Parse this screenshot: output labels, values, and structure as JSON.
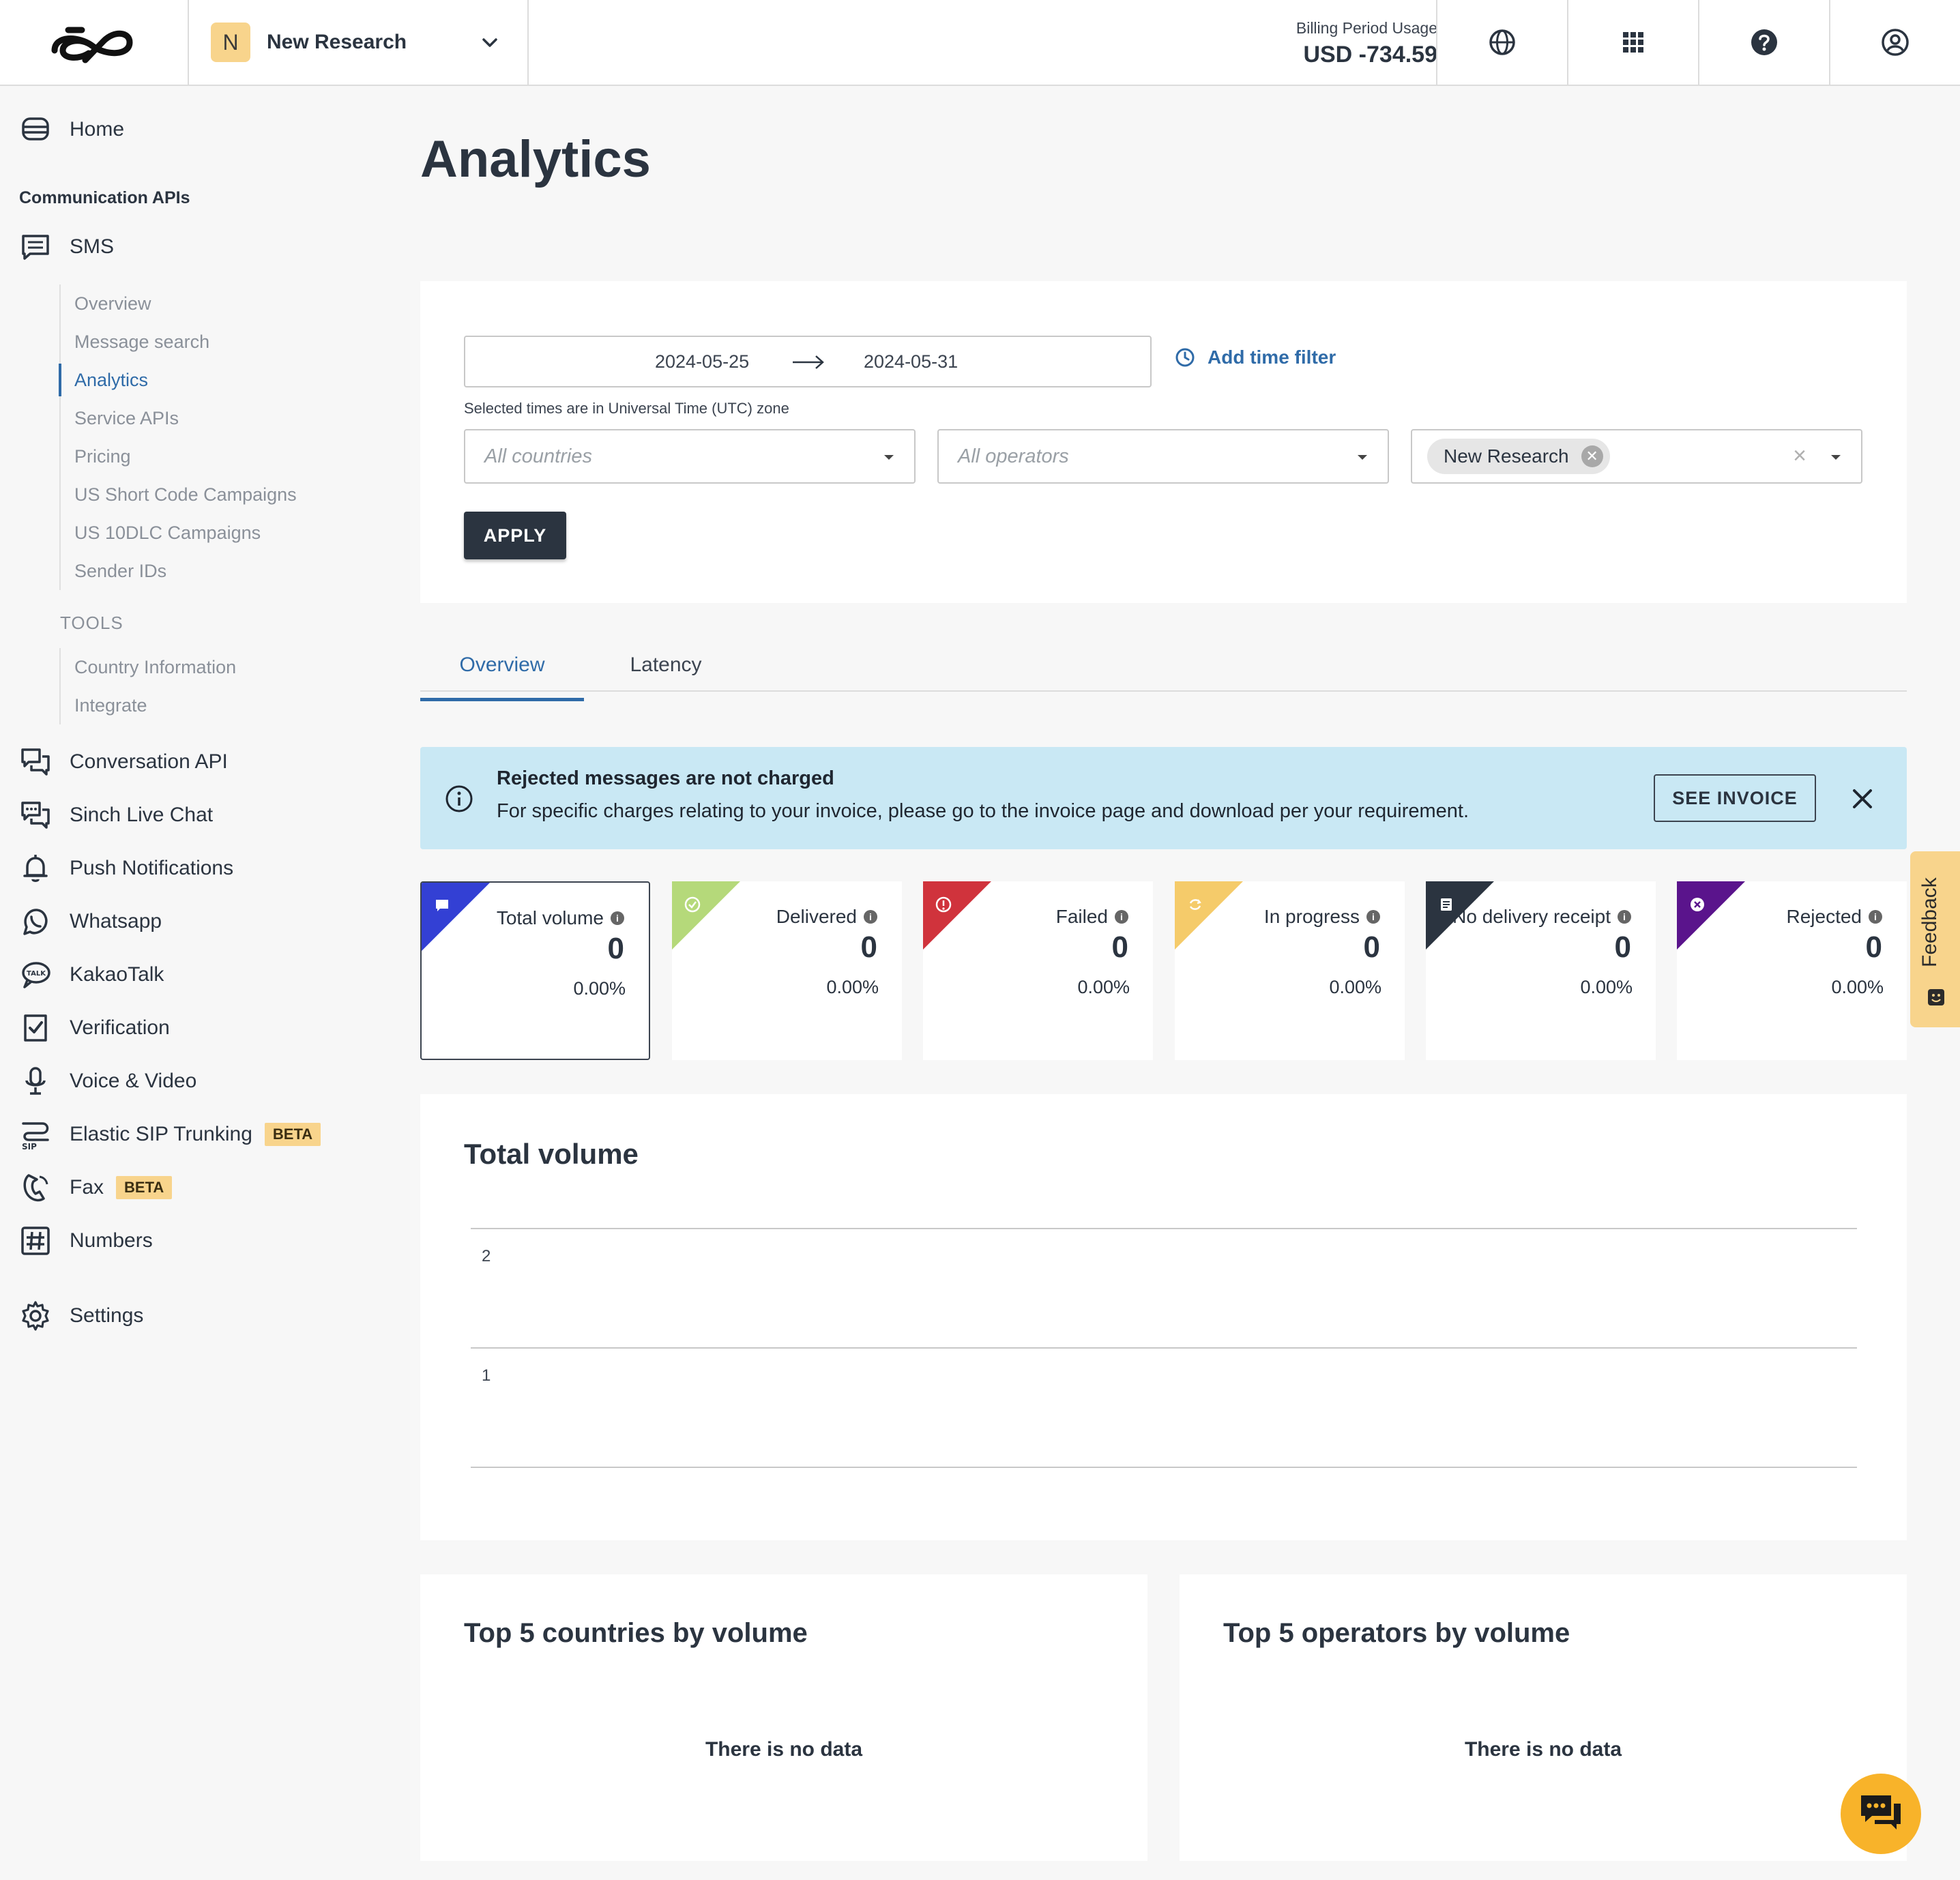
{
  "header": {
    "project_initial": "N",
    "project_name": "New Research",
    "billing_label": "Billing Period Usage",
    "billing_value": "USD -734.59",
    "icons": [
      "globe-icon",
      "apps-grid-icon",
      "help-icon",
      "account-icon"
    ]
  },
  "sidebar": {
    "home": "Home",
    "section_title": "Communication APIs",
    "sms": "SMS",
    "sms_items": [
      "Overview",
      "Message search",
      "Analytics",
      "Service APIs",
      "Pricing",
      "US Short Code Campaigns",
      "US 10DLC Campaigns",
      "Sender IDs"
    ],
    "active_sms_item": "Analytics",
    "tools_title": "TOOLS",
    "tools_items": [
      "Country Information",
      "Integrate"
    ],
    "products": [
      {
        "label": "Conversation API",
        "icon": "conversation-icon"
      },
      {
        "label": "Sinch Live Chat",
        "icon": "live-chat-icon"
      },
      {
        "label": "Push Notifications",
        "icon": "bell-icon"
      },
      {
        "label": "Whatsapp",
        "icon": "whatsapp-icon"
      },
      {
        "label": "KakaoTalk",
        "icon": "kakaotalk-icon"
      },
      {
        "label": "Verification",
        "icon": "verification-icon"
      },
      {
        "label": "Voice & Video",
        "icon": "microphone-icon"
      },
      {
        "label": "Elastic SIP Trunking",
        "icon": "sip-icon",
        "badge": "BETA"
      },
      {
        "label": "Fax",
        "icon": "fax-icon",
        "badge": "BETA"
      },
      {
        "label": "Numbers",
        "icon": "hash-icon"
      }
    ],
    "settings": "Settings"
  },
  "page": {
    "title": "Analytics"
  },
  "filters": {
    "date_from": "2024-05-25",
    "date_to": "2024-05-31",
    "add_time_filter": "Add time filter",
    "utc_note": "Selected times are in Universal Time (UTC) zone",
    "countries_placeholder": "All countries",
    "operators_placeholder": "All operators",
    "project_chip": "New Research",
    "apply": "APPLY"
  },
  "tabs": [
    "Overview",
    "Latency"
  ],
  "active_tab": "Overview",
  "banner": {
    "title": "Rejected messages are not charged",
    "text": "For specific charges relating to your invoice, please go to the invoice page and download per your requirement.",
    "button": "SEE INVOICE"
  },
  "stats": [
    {
      "label": "Total volume",
      "value": "0",
      "pct": "0.00%",
      "color": "#3340d4",
      "icon": "message-icon"
    },
    {
      "label": "Delivered",
      "value": "0",
      "pct": "0.00%",
      "color": "#b5d97a",
      "icon": "check-icon"
    },
    {
      "label": "Failed",
      "value": "0",
      "pct": "0.00%",
      "color": "#d0333c",
      "icon": "alert-icon"
    },
    {
      "label": "In progress",
      "value": "0",
      "pct": "0.00%",
      "color": "#f5cb6a",
      "icon": "refresh-icon"
    },
    {
      "label": "No delivery receipt",
      "value": "0",
      "pct": "0.00%",
      "color": "#2b3440",
      "icon": "receipt-icon"
    },
    {
      "label": "Rejected",
      "value": "0",
      "pct": "0.00%",
      "color": "#5a148c",
      "icon": "x-circle-icon"
    }
  ],
  "feedback": "Feedback",
  "volume_chart": {
    "title": "Total volume"
  },
  "chart_data": {
    "type": "line",
    "title": "Total volume",
    "xlabel": "",
    "ylabel": "",
    "y_ticks": [
      "2",
      "1"
    ],
    "ylim": [
      0,
      2
    ],
    "series": [],
    "grid": true
  },
  "top_countries": {
    "title": "Top 5 countries by volume",
    "empty": "There is no data"
  },
  "top_operators": {
    "title": "Top 5 operators by volume",
    "empty": "There is no data"
  }
}
